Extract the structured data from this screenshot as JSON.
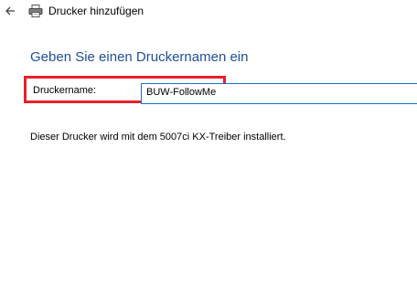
{
  "window": {
    "title": "Drucker hinzufügen",
    "back_icon": "back-arrow-icon",
    "app_icon": "printer-icon"
  },
  "main": {
    "heading": "Geben Sie einen Druckernamen ein",
    "printer_name_label": "Druckername:",
    "printer_name_value": "BUW-FollowMe",
    "info": "Dieser Drucker wird mit dem 5007ci KX-Treiber installiert."
  },
  "colors": {
    "heading": "#1f4e9a",
    "highlight": "#e8202a",
    "input_border": "#1f6fbf"
  }
}
